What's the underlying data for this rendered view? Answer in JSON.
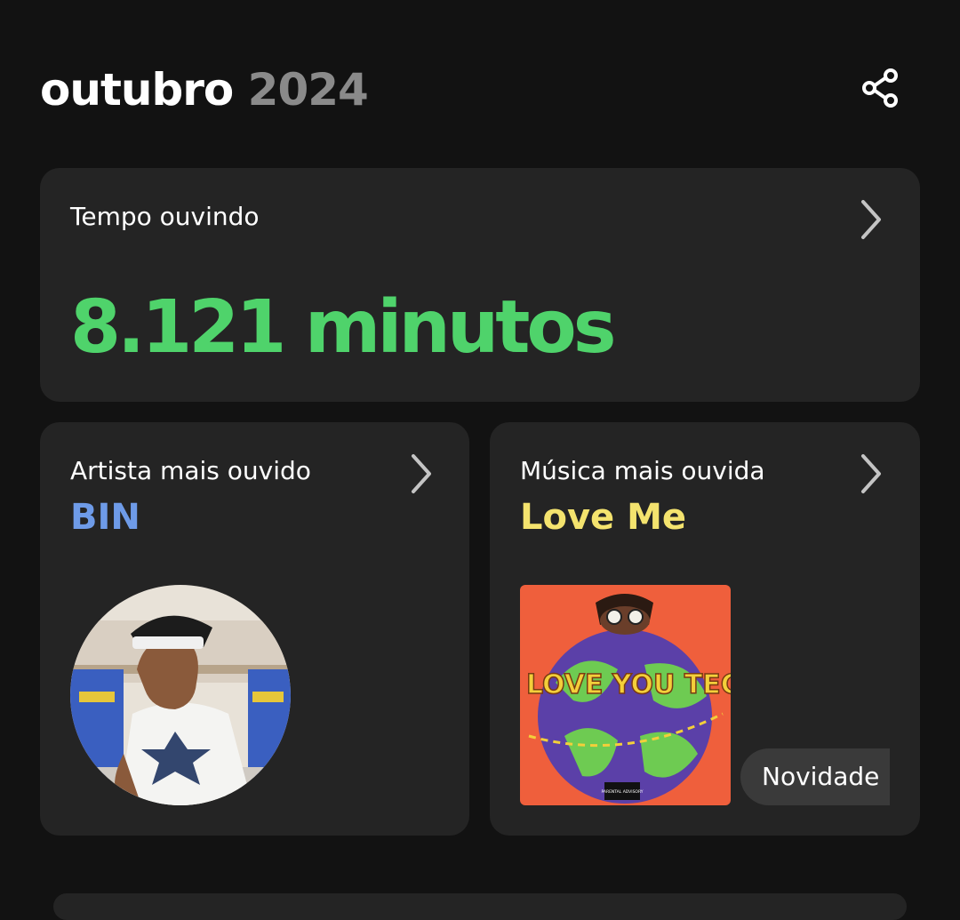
{
  "header": {
    "month": "outubro",
    "year": "2024",
    "share_icon": "share-icon"
  },
  "listening_time": {
    "label": "Tempo ouvindo",
    "value": "8.121 minutos",
    "value_color": "#4fd36b"
  },
  "top_artist": {
    "label": "Artista mais ouvido",
    "name": "BIN",
    "name_color": "#6e9be8"
  },
  "top_song": {
    "label": "Música mais ouvida",
    "name": "Love Me",
    "name_color": "#f4e36e",
    "cover_text": "WE LOVE YOU TECCA",
    "advisory_text": "PARENTAL ADVISORY",
    "badge": "Novidade"
  },
  "colors": {
    "background": "#121212",
    "card": "#242424",
    "year": "#8a8a8a"
  }
}
